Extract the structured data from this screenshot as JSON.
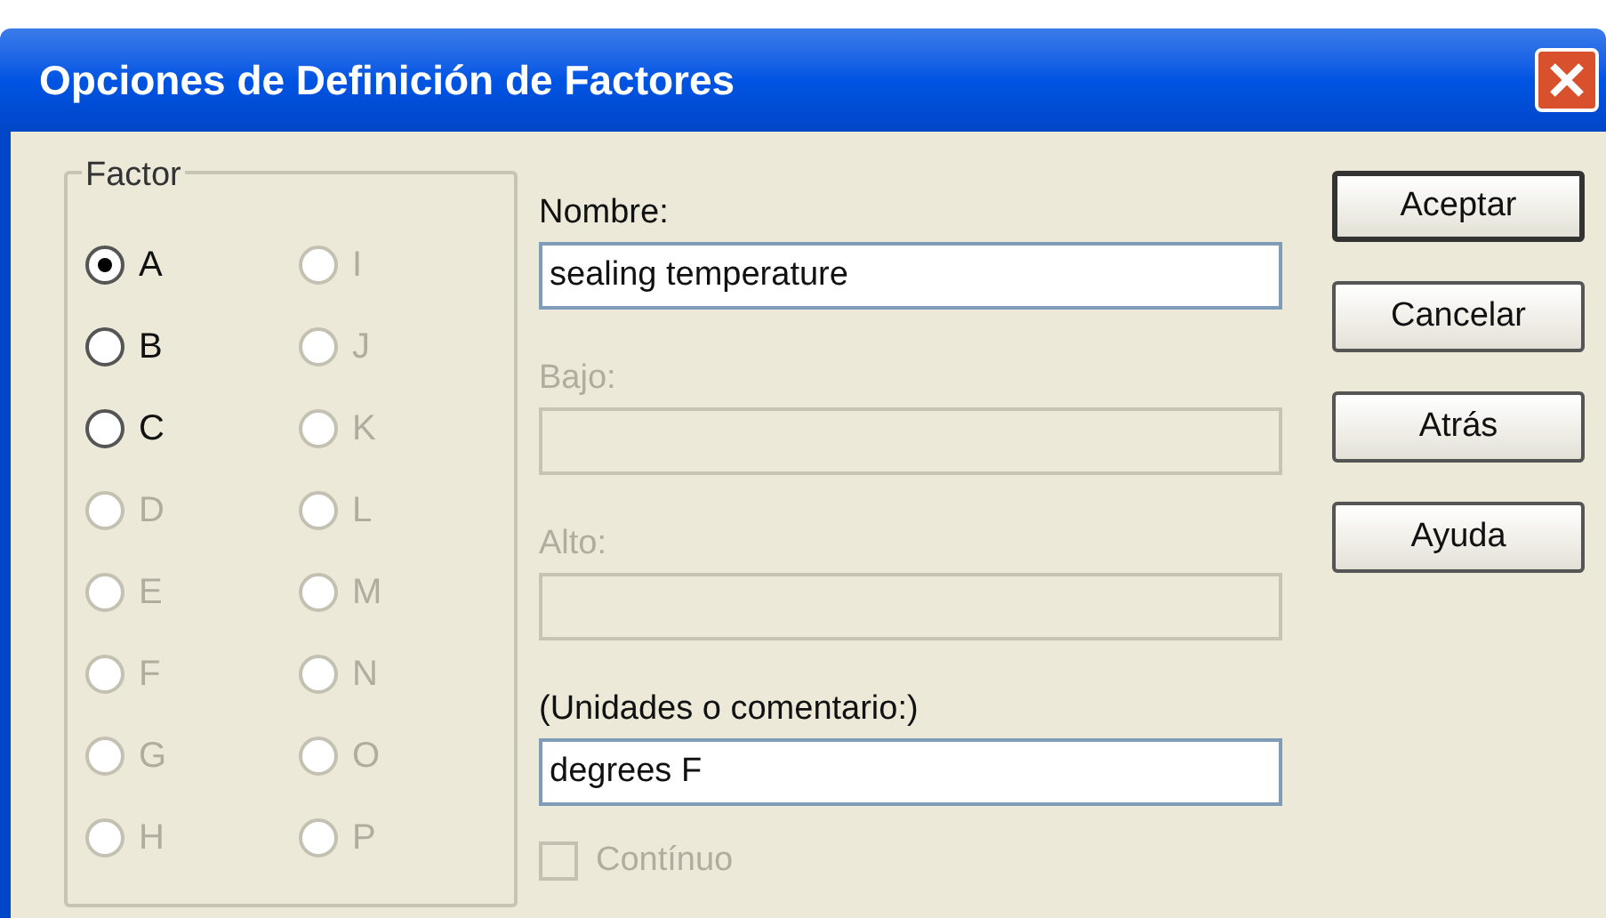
{
  "window": {
    "title": "Opciones de Definición de Factores"
  },
  "factor_group": {
    "label": "Factor",
    "options": [
      {
        "label": "A",
        "selected": true,
        "disabled": false
      },
      {
        "label": "B",
        "selected": false,
        "disabled": false
      },
      {
        "label": "C",
        "selected": false,
        "disabled": false
      },
      {
        "label": "D",
        "selected": false,
        "disabled": true
      },
      {
        "label": "E",
        "selected": false,
        "disabled": true
      },
      {
        "label": "F",
        "selected": false,
        "disabled": true
      },
      {
        "label": "G",
        "selected": false,
        "disabled": true
      },
      {
        "label": "H",
        "selected": false,
        "disabled": true
      },
      {
        "label": "I",
        "selected": false,
        "disabled": true
      },
      {
        "label": "J",
        "selected": false,
        "disabled": true
      },
      {
        "label": "K",
        "selected": false,
        "disabled": true
      },
      {
        "label": "L",
        "selected": false,
        "disabled": true
      },
      {
        "label": "M",
        "selected": false,
        "disabled": true
      },
      {
        "label": "N",
        "selected": false,
        "disabled": true
      },
      {
        "label": "O",
        "selected": false,
        "disabled": true
      },
      {
        "label": "P",
        "selected": false,
        "disabled": true
      }
    ]
  },
  "fields": [
    {
      "label": "Nombre:",
      "value": "sealing temperature",
      "disabled": false
    },
    {
      "label": "Bajo:",
      "disabled": true
    },
    {
      "label": "Alto:",
      "disabled": true
    },
    {
      "label": "(Unidades o comentario:)",
      "value": "degrees F",
      "disabled": false
    }
  ],
  "continuous_checkbox": {
    "label": "Contínuo",
    "checked": false,
    "disabled": true
  },
  "buttons": [
    {
      "label": "Aceptar",
      "default": true
    },
    {
      "label": "Cancelar",
      "default": false
    },
    {
      "label": "Atrás",
      "default": false
    },
    {
      "label": "Ayuda",
      "default": false
    }
  ]
}
